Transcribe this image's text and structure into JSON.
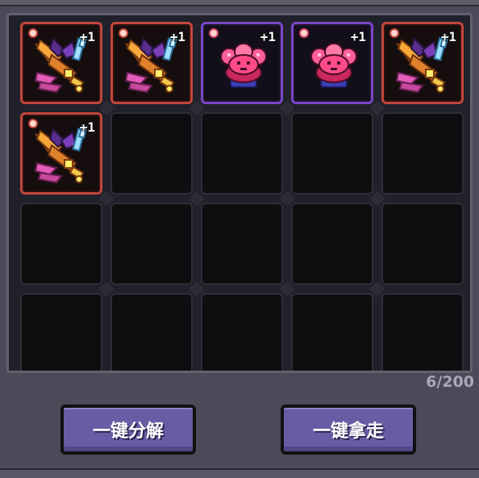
{
  "inventory": {
    "rows": 4,
    "cols": 5,
    "slots": [
      {
        "item": "rune-sword-icon",
        "rarity": "red",
        "badge": "+1"
      },
      {
        "item": "rune-sword-icon",
        "rarity": "red",
        "badge": "+1"
      },
      {
        "item": "pink-flower-icon",
        "rarity": "purple",
        "badge": "+1"
      },
      {
        "item": "pink-flower-icon",
        "rarity": "purple",
        "badge": "+1"
      },
      {
        "item": "rune-sword-icon",
        "rarity": "red",
        "badge": "+1"
      },
      {
        "item": "rune-sword-icon",
        "rarity": "red",
        "badge": "+1"
      }
    ],
    "count_label": "6/200"
  },
  "actions": {
    "decompose_label": "一键分解",
    "take_all_label": "一键拿走"
  },
  "colors": {
    "red_rarity": "#c2463a",
    "purple_rarity": "#7b46c8",
    "button": "#6a5ca4"
  }
}
